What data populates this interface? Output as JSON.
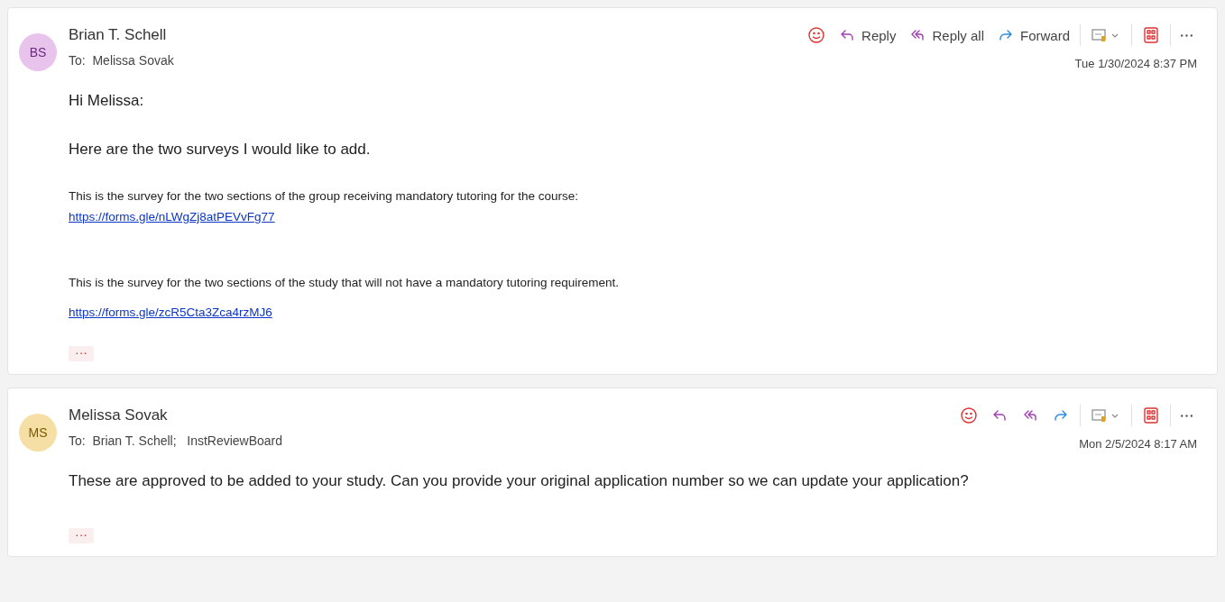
{
  "messages": [
    {
      "initials": "BS",
      "color": "#e8c4ec",
      "sender": "Brian T. Schell",
      "to_label": "To:",
      "recipients": [
        "Melissa Sovak"
      ],
      "date": "Tue 1/30/2024 8:37 PM",
      "actions": [
        {
          "kind": "react"
        },
        {
          "kind": "reply",
          "label": "Reply"
        },
        {
          "kind": "reply_all",
          "label": "Reply all"
        },
        {
          "kind": "forward",
          "label": "Forward"
        },
        {
          "kind": "note"
        },
        {
          "kind": "apps"
        },
        {
          "kind": "more"
        }
      ],
      "body": [
        {
          "kind": "text",
          "text": "Hi Melissa:"
        },
        {
          "kind": "text",
          "text": "Here are the two surveys I would like to add."
        },
        {
          "kind": "small",
          "text": "This is the survey for the two sections of the group receiving mandatory tutoring for the course:"
        },
        {
          "kind": "link",
          "text": "https://forms.gle/nLWgZj8atPEVvFg77"
        },
        {
          "kind": "small",
          "text": "This is the survey for the two sections of the study that will not have a mandatory tutoring requirement."
        },
        {
          "kind": "link",
          "text": "https://forms.gle/zcR5Cta3Zca4rzMJ6"
        }
      ],
      "expand": "···"
    },
    {
      "initials": "MS",
      "color": "#f6dfa4",
      "sender": "Melissa Sovak",
      "to_label": "To:",
      "recipients": [
        "Brian T. Schell;",
        "InstReviewBoard"
      ],
      "date": "Mon 2/5/2024 8:17 AM",
      "actions": [
        {
          "kind": "react"
        },
        {
          "kind": "reply"
        },
        {
          "kind": "reply_all"
        },
        {
          "kind": "forward"
        },
        {
          "kind": "note"
        },
        {
          "kind": "apps"
        },
        {
          "kind": "more"
        }
      ],
      "body": [
        {
          "kind": "text",
          "text": "These are approved to be added to your study.  Can you provide your original application number so we can update your application?"
        }
      ],
      "expand": "···"
    }
  ]
}
